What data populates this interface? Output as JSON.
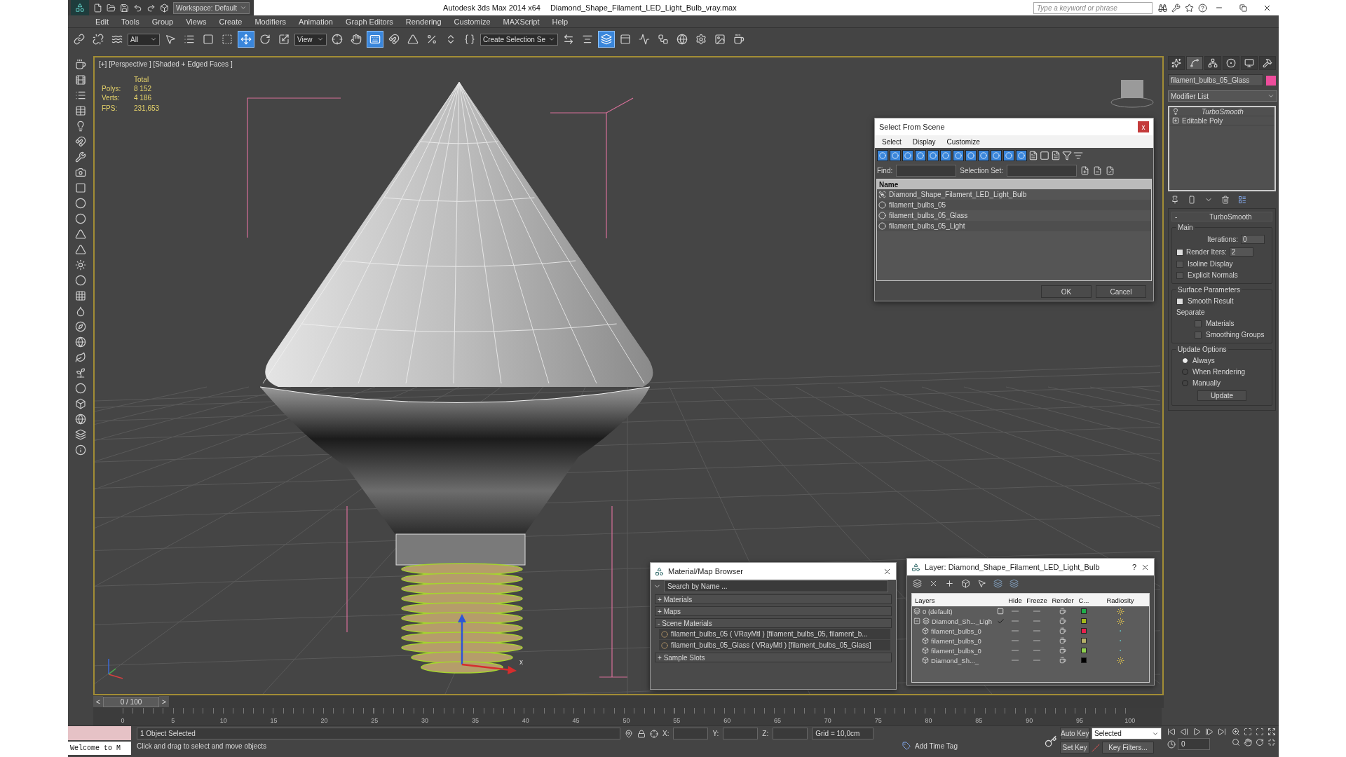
{
  "title_bar": {
    "workspace": "Workspace: Default",
    "app": "Autodesk 3ds Max  2014 x64",
    "file": "Diamond_Shape_Filament_LED_Light_Bulb_vray.max",
    "search_placeholder": "Type a keyword or phrase"
  },
  "menu": [
    "Edit",
    "Tools",
    "Group",
    "Views",
    "Create",
    "Modifiers",
    "Animation",
    "Graph Editors",
    "Rendering",
    "Customize",
    "MAXScript",
    "Help"
  ],
  "toolbar": [
    {
      "kind": "link",
      "selected": false
    },
    {
      "kind": "unlink",
      "selected": false
    },
    {
      "kind": "bind",
      "selected": false
    },
    {
      "kind": "dropdown",
      "value": "All"
    },
    {
      "kind": "select",
      "selected": false
    },
    {
      "kind": "select_by_name",
      "selected": false
    },
    {
      "kind": "region",
      "selected": false
    },
    {
      "kind": "crossing",
      "selected": false
    },
    {
      "kind": "move",
      "selected": true
    },
    {
      "kind": "rotate",
      "selected": false
    },
    {
      "kind": "scale",
      "selected": false
    },
    {
      "kind": "dropdown",
      "value": "View"
    },
    {
      "kind": "pivot",
      "selected": false
    },
    {
      "kind": "manipulate",
      "selected": false
    },
    {
      "kind": "keyboard",
      "selected": true
    },
    {
      "kind": "snap",
      "selected": false
    },
    {
      "kind": "angle_snap",
      "selected": false
    },
    {
      "kind": "percent_snap",
      "selected": false
    },
    {
      "kind": "spinner_snap",
      "selected": false
    },
    {
      "kind": "named_sets",
      "selected": false
    },
    {
      "kind": "dropdown",
      "value": "Create Selection Se"
    },
    {
      "kind": "mirror",
      "selected": false
    },
    {
      "kind": "align",
      "selected": false
    },
    {
      "kind": "layers",
      "selected": true
    },
    {
      "kind": "ribbon",
      "selected": false
    },
    {
      "kind": "curves",
      "selected": false
    },
    {
      "kind": "schematic",
      "selected": false
    },
    {
      "kind": "material",
      "selected": false
    },
    {
      "kind": "render_setup",
      "selected": false
    },
    {
      "kind": "frame",
      "selected": false
    },
    {
      "kind": "render",
      "selected": false
    }
  ],
  "viewport": {
    "label": "[+] [Perspective ] [Shaded + Edged Faces ]",
    "stats_header": "Total",
    "stats": [
      {
        "label": "Polys:",
        "value": "8 152"
      },
      {
        "label": "Verts:",
        "value": "4 186"
      }
    ],
    "fps_label": "FPS:",
    "fps_value": "231,653",
    "gizmo_label": "x"
  },
  "command_panel": {
    "tabs": [
      {
        "kind": "create",
        "selected": false
      },
      {
        "kind": "modify",
        "selected": true
      },
      {
        "kind": "hierarchy",
        "selected": false
      },
      {
        "kind": "motion",
        "selected": false
      },
      {
        "kind": "display",
        "selected": false
      },
      {
        "kind": "utilities",
        "selected": false
      }
    ],
    "object_name": "filament_bulbs_05_Glass",
    "modifier_list": "Modifier List",
    "stack": [
      {
        "name": "TurboSmooth",
        "kind": "modifier"
      },
      {
        "name": "Editable Poly",
        "kind": "base"
      }
    ],
    "rollout": {
      "collapse": "-",
      "title": "TurboSmooth",
      "main_group": "Main",
      "iterations_label": "Iterations:",
      "iterations": "0",
      "render_iters_label": "Render Iters:",
      "render_iters_checked": true,
      "render_iters": "2",
      "main_checks": [
        {
          "label": "Isoline Display",
          "checked": false
        },
        {
          "label": "Explicit Normals",
          "checked": false
        }
      ],
      "surface_group": "Surface Parameters",
      "smooth_result": {
        "label": "Smooth Result",
        "checked": true
      },
      "separate_label": "Separate",
      "separate": [
        {
          "label": "Materials",
          "checked": false
        },
        {
          "label": "Smoothing Groups",
          "checked": false
        }
      ],
      "update_group": "Update Options",
      "update_modes": [
        {
          "label": "Always",
          "selected": true
        },
        {
          "label": "When Rendering",
          "selected": false
        },
        {
          "label": "Manually",
          "selected": false
        }
      ],
      "update_button": "Update"
    }
  },
  "select_from_scene": {
    "title": "Select From Scene",
    "close": "x",
    "menu": [
      "Select",
      "Display",
      "Customize"
    ],
    "filters": [
      {
        "on": true
      },
      {
        "on": true
      },
      {
        "on": true
      },
      {
        "on": true
      },
      {
        "on": true
      },
      {
        "on": true
      },
      {
        "on": true
      },
      {
        "on": true
      },
      {
        "on": true
      },
      {
        "on": true
      },
      {
        "on": true
      },
      {
        "on": true
      }
    ],
    "find_label": "Find:",
    "selection_set_label": "Selection Set:",
    "column": "Name",
    "items": [
      {
        "name": "Diamond_Shape_Filament_LED_Light_Bulb",
        "kind": "group"
      },
      {
        "name": "filament_bulbs_05",
        "kind": "geometry"
      },
      {
        "name": "filament_bulbs_05_Glass",
        "kind": "geometry"
      },
      {
        "name": "filament_bulbs_05_Light",
        "kind": "geometry"
      }
    ],
    "buttons": [
      "OK",
      "Cancel"
    ]
  },
  "material_browser": {
    "title": "Material/Map Browser",
    "search_placeholder": "Search by Name ...",
    "sections": [
      {
        "sign": "+",
        "label": "Materials"
      },
      {
        "sign": "+",
        "label": "Maps"
      },
      {
        "sign": "-",
        "label": "Scene Materials",
        "items": [
          "filament_bulbs_05 ( VRayMtl ) [filament_bulbs_05, filament_b...",
          "filament_bulbs_05_Glass ( VRayMtl ) [filament_bulbs_05_Glass]"
        ]
      },
      {
        "sign": "+",
        "label": "Sample Slots"
      }
    ]
  },
  "layer_manager": {
    "title": "Layer: Diamond_Shape_Filament_LED_Light_Bulb",
    "help": "?",
    "columns": [
      "Layers",
      "Hide",
      "Freeze",
      "Render",
      "C...",
      "Radiosity"
    ],
    "rows": [
      {
        "name": "0 (default)",
        "kind": "layer",
        "current": false,
        "color": "#1fae4a"
      },
      {
        "name": "Diamond_Sh..._Ligh",
        "kind": "layer",
        "current": true,
        "expanded": true,
        "color": "#a3b81a",
        "children": [
          {
            "name": "filament_bulbs_0",
            "kind": "object",
            "color": "#e8214c"
          },
          {
            "name": "filament_bulbs_0",
            "kind": "object",
            "color": "#b5b06a"
          },
          {
            "name": "filament_bulbs_0",
            "kind": "object",
            "color": "#8fd04f"
          },
          {
            "name": "Diamond_Sh..._",
            "kind": "group",
            "color": "#000000"
          }
        ]
      }
    ]
  },
  "time_slider": {
    "prev": "<",
    "position": "0 / 100",
    "next": ">"
  },
  "ruler": [
    "0",
    "5",
    "10",
    "15",
    "20",
    "25",
    "30",
    "35",
    "40",
    "45",
    "50",
    "55",
    "60",
    "65",
    "70",
    "75",
    "80",
    "85",
    "90",
    "95",
    "100"
  ],
  "status_bar": {
    "listener": "Welcome to M",
    "selected": "1 Object Selected",
    "prompt": "Click and drag to select and move objects",
    "x_label": "X:",
    "y_label": "Y:",
    "z_label": "Z:",
    "grid": "Grid = 10,0cm",
    "add_time_tag": "Add Time Tag",
    "auto_key": "Auto Key",
    "set_key": "Set Key",
    "key_mode": "Selected",
    "key_filters": "Key Filters...",
    "frame": "0"
  }
}
